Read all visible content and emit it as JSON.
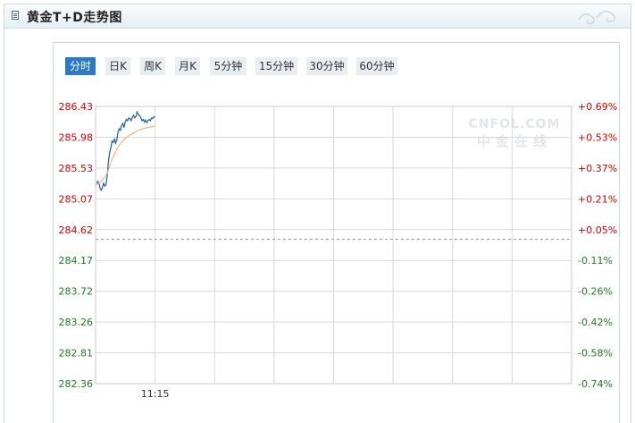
{
  "header": {
    "title": "黄金T+D走势图"
  },
  "tabs": [
    {
      "label": "分时",
      "active": true
    },
    {
      "label": "日K",
      "active": false
    },
    {
      "label": "周K",
      "active": false
    },
    {
      "label": "月K",
      "active": false
    },
    {
      "label": "5分钟",
      "active": false
    },
    {
      "label": "15分钟",
      "active": false
    },
    {
      "label": "30分钟",
      "active": false
    },
    {
      "label": "60分钟",
      "active": false
    }
  ],
  "watermark": {
    "top": "CNFOL.COM",
    "bottom": "中金在线"
  },
  "colors": {
    "price_line": "#1f5ea8",
    "avg_line": "#f2b48a",
    "up_text": "#d40000",
    "down_text": "#1f7a1f",
    "grid": "#d9d9d9",
    "ref_line": "#9a9a9a"
  },
  "chart_data": {
    "type": "line",
    "x_tick_labels": [
      "11:15"
    ],
    "y_tick_labels": [
      "286.43",
      "285.98",
      "285.53",
      "285.07",
      "284.62",
      "284.17",
      "283.72",
      "283.26",
      "282.81",
      "282.36"
    ],
    "y_right_tick_labels": [
      "+0.69%",
      "+0.53%",
      "+0.37%",
      "+0.21%",
      "+0.05%",
      "-0.11%",
      "-0.26%",
      "-0.42%",
      "-0.58%",
      "-0.74%"
    ],
    "ylim": [
      282.36,
      286.43
    ],
    "reference_price": 284.48,
    "series": [
      {
        "role": "price",
        "values": [
          285.28,
          285.33,
          285.31,
          285.23,
          285.2,
          285.24,
          285.3,
          285.26,
          285.28,
          285.42,
          285.62,
          285.75,
          285.82,
          285.92,
          285.9,
          285.95,
          285.89,
          285.94,
          286.05,
          286.1,
          286.08,
          286.15,
          286.18,
          286.12,
          286.2,
          286.24,
          286.22,
          286.26,
          286.25,
          286.22,
          286.27,
          286.3,
          286.26,
          286.28,
          286.35,
          286.31,
          286.3,
          286.27,
          286.22,
          286.24,
          286.2,
          286.23,
          286.19,
          286.22,
          286.24,
          286.22,
          286.26,
          286.25,
          286.28,
          286.27
        ]
      },
      {
        "role": "average",
        "values": [
          285.28,
          285.3,
          285.31,
          285.32,
          285.33,
          285.35,
          285.37,
          285.39,
          285.42,
          285.45,
          285.5,
          285.55,
          285.6,
          285.65,
          285.69,
          285.73,
          285.76,
          285.8,
          285.83,
          285.86,
          285.88,
          285.9,
          285.92,
          285.94,
          285.96,
          285.97,
          285.99,
          286.0,
          286.01,
          286.02,
          286.03,
          286.04,
          286.05,
          286.06,
          286.07,
          286.08,
          286.08,
          286.09,
          286.1,
          286.1,
          286.11,
          286.11,
          286.12,
          286.12,
          286.12,
          286.13,
          286.13,
          286.13,
          286.14,
          286.14
        ]
      }
    ],
    "grid": true
  }
}
